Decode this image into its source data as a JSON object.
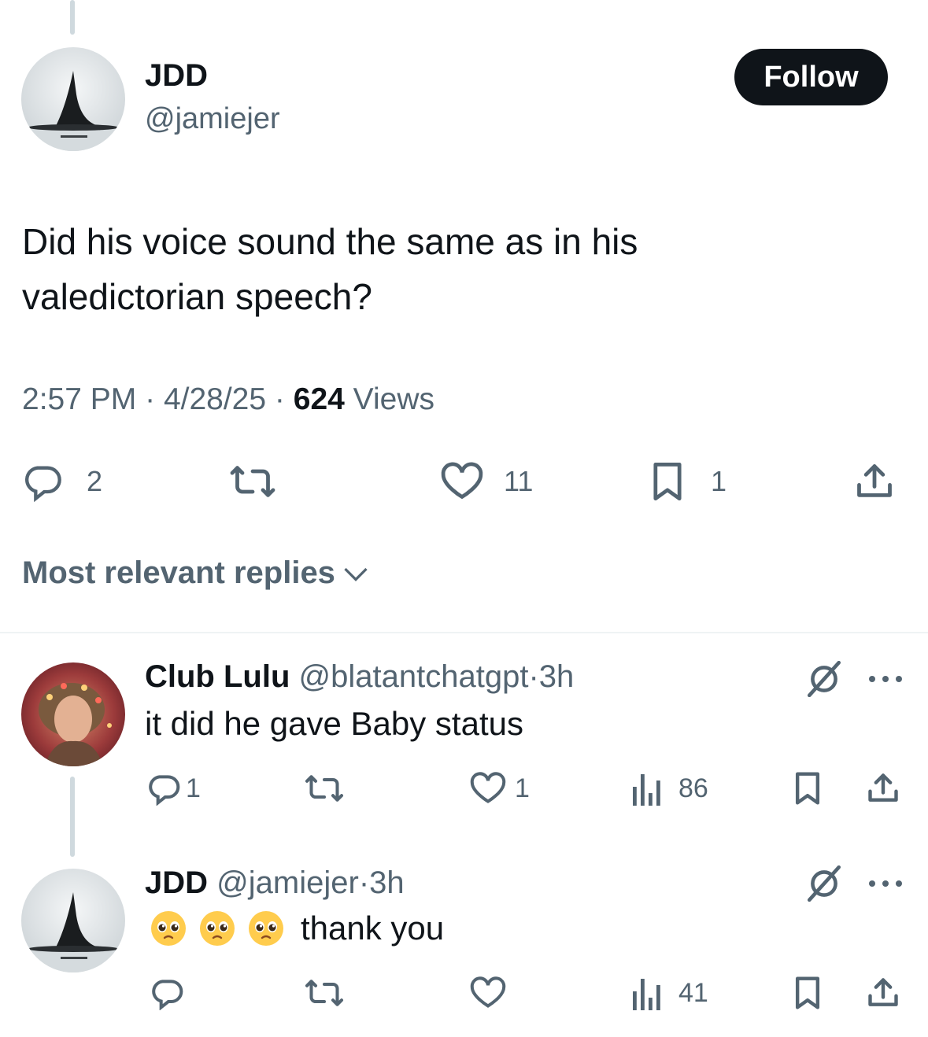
{
  "main_tweet": {
    "display_name": "JDD",
    "handle": "@jamiejer",
    "follow_label": "Follow",
    "text_line1": "Did his voice sound the same as in his",
    "text_line2": "valedictorian speech?",
    "time": "2:57 PM",
    "date": "4/28/25",
    "views_count": "624",
    "views_label": "Views",
    "separator": "·",
    "replies": "2",
    "likes": "11",
    "bookmarks": "1"
  },
  "sort": {
    "label": "Most relevant replies"
  },
  "replies": [
    {
      "display_name": "Club Lulu",
      "handle": "@blatantchatgpt",
      "time": "3h",
      "separator": "·",
      "text": "it did he gave Baby status",
      "replies": "1",
      "likes": "1",
      "views": "86"
    },
    {
      "display_name": "JDD",
      "handle": "@jamiejer",
      "time": "3h",
      "separator": "·",
      "emoji": [
        "pleading-face",
        "pleading-face",
        "pleading-face"
      ],
      "text": "thank you",
      "views": "41"
    }
  ],
  "colors": {
    "text": "#0f1419",
    "secondary": "#536471",
    "border": "#eff3f4",
    "thread": "#cfd9de"
  }
}
